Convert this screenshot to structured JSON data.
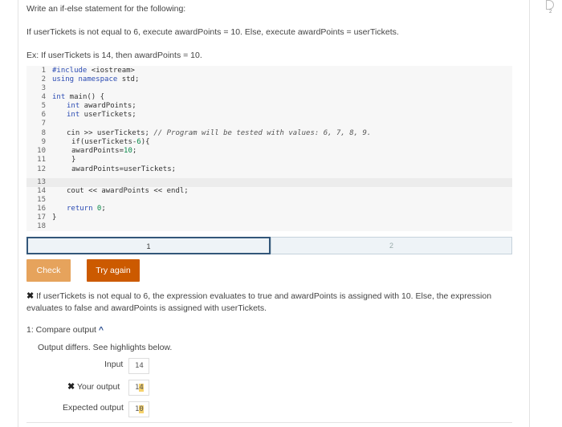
{
  "prompt": {
    "line1": "Write an if-else statement for the following:",
    "line2": "If userTickets is not equal to 6, execute awardPoints = 10. Else, execute awardPoints = userTickets.",
    "line3": "Ex: If userTickets is 14, then awardPoints = 10."
  },
  "corner_badge": "2",
  "code": {
    "line_numbers": [
      "1",
      "2",
      "3",
      "4",
      "5",
      "6",
      "7",
      "8",
      "9",
      "10",
      "11",
      "12",
      "13",
      "14",
      "15",
      "16",
      "17",
      "18"
    ],
    "l1_pre": "#include",
    "l1_post": " <iostream>",
    "l2_kw": "using",
    "l2_ns": " namespace",
    "l2_post": " std;",
    "l4_kw": "int",
    "l4_post": " main() {",
    "l5_kw": "int",
    "l5_post": " awardPoints;",
    "l6_kw": "int",
    "l6_post": " userTickets;",
    "l8_code": "cin >> userTickets; ",
    "l8_comment": "// Program will be tested with values: 6, 7, 8, 9.",
    "l9_pre": "if(userTickets-",
    "l9_num": "6",
    "l9_post": "){",
    "l10_pre": "awardPoints=",
    "l10_num": "10",
    "l10_post": ";",
    "l11": "}",
    "l12": "awardPoints=userTickets;",
    "l14": "cout << awardPoints << endl;",
    "l16_kw": "return",
    "l16_num": " 0",
    "l16_post": ";",
    "l17": "}"
  },
  "progress": {
    "seg1": "1",
    "seg2": "2"
  },
  "buttons": {
    "check": "Check",
    "retry": "Try again"
  },
  "feedback": {
    "mark": "✖",
    "line1": "If userTickets is not equal to 6, the expression evaluates to true and awardPoints is assigned with 10. Else, the expression",
    "line2": "evaluates to false and awardPoints is assigned with userTickets."
  },
  "compare": {
    "title": "1: Compare output",
    "caret": "^",
    "status": "Output differs. See highlights below.",
    "input_label": "Input",
    "input_value": "14",
    "your_mark": "✖",
    "your_label": "Your output",
    "your_value_a": "1",
    "your_value_b": "4",
    "expected_label": "Expected output",
    "expected_value_a": "1",
    "expected_value_b": "0"
  }
}
